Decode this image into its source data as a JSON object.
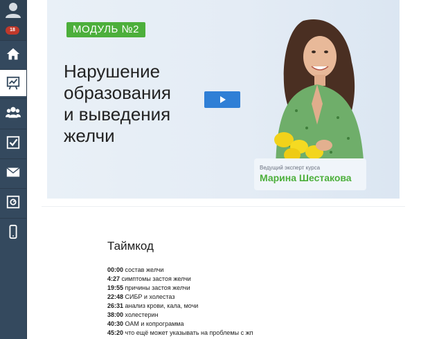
{
  "sidebar": {
    "notification_count": "18",
    "items": [
      {
        "icon": "home-icon",
        "active": false
      },
      {
        "icon": "presentation-chart-icon",
        "active": true
      },
      {
        "icon": "users-icon",
        "active": false
      },
      {
        "icon": "checkbox-icon",
        "active": false
      },
      {
        "icon": "mail-icon",
        "active": false
      },
      {
        "icon": "safe-icon",
        "active": false
      },
      {
        "icon": "mobile-icon",
        "active": false
      }
    ]
  },
  "hero": {
    "module_label": "МОДУЛЬ №2",
    "title_lines": [
      "Нарушение",
      "образования",
      "и выведения",
      "желчи"
    ],
    "expert_role": "Ведущий эксперт курса",
    "expert_name": "Марина Шестакова",
    "accent_color": "#4caf3b",
    "play_color": "#2f7fd6"
  },
  "timecodes": {
    "title": "Таймкод",
    "items": [
      {
        "time": "00:00",
        "text": "состав желчи"
      },
      {
        "time": "4:27",
        "text": "симптомы застоя желчи"
      },
      {
        "time": "19:55",
        "text": "причины застоя желчи"
      },
      {
        "time": "22:48",
        "text": "СИБР и холестаз"
      },
      {
        "time": "26:31",
        "text": "анализ крови, кала, мочи"
      },
      {
        "time": "38:00",
        "text": "холестерин"
      },
      {
        "time": "40:30",
        "text": "ОАМ и копрограмма"
      },
      {
        "time": "45:20",
        "text": "что ещё может указывать на проблемы с жп"
      }
    ]
  }
}
